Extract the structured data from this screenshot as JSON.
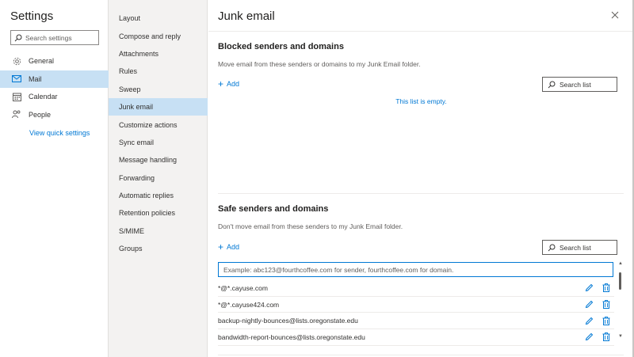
{
  "settings": {
    "title": "Settings",
    "search_placeholder": "Search settings",
    "nav": [
      {
        "label": "General",
        "icon": "gear-icon"
      },
      {
        "label": "Mail",
        "icon": "mail-icon",
        "selected": true
      },
      {
        "label": "Calendar",
        "icon": "calendar-icon"
      },
      {
        "label": "People",
        "icon": "people-icon"
      }
    ],
    "quick_settings": "View quick settings"
  },
  "mail_menu": {
    "items": [
      "Layout",
      "Compose and reply",
      "Attachments",
      "Rules",
      "Sweep",
      "Junk email",
      "Customize actions",
      "Sync email",
      "Message handling",
      "Forwarding",
      "Automatic replies",
      "Retention policies",
      "S/MIME",
      "Groups"
    ],
    "selected": "Junk email"
  },
  "pane": {
    "title": "Junk email",
    "close_icon": "close-icon",
    "blocked": {
      "title": "Blocked senders and domains",
      "description": "Move email from these senders or domains to my Junk Email folder.",
      "add_label": "Add",
      "search_label": "Search list",
      "empty_text": "This list is empty."
    },
    "safe": {
      "title": "Safe senders and domains",
      "description": "Don't move email from these senders to my Junk Email folder.",
      "add_label": "Add",
      "search_label": "Search list",
      "input_placeholder": "Example: abc123@fourthcoffee.com for sender, fourthcoffee.com for domain.",
      "entries": [
        "*@*.cayuse.com",
        "*@*.cayuse424.com",
        "backup-nightly-bounces@lists.oregonstate.edu",
        "bandwidth-report-bounces@lists.oregonstate.edu"
      ]
    }
  },
  "colors": {
    "accent": "#0078d4",
    "selected_bg": "#c7e0f4",
    "menu_bg": "#f3f2f1"
  }
}
